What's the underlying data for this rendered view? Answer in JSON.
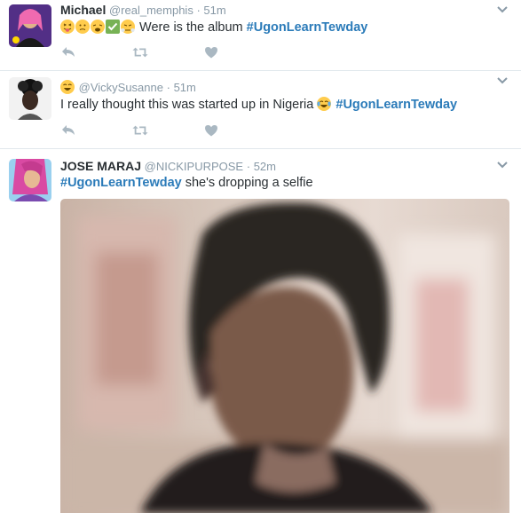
{
  "tweets": [
    {
      "name": "Michael",
      "handle": "@real_memphis",
      "separator": "·",
      "time": "51m",
      "emojis": [
        "squinting-tongue-emoji",
        "confused-face-emoji",
        "weary-face-emoji",
        "check-mark-emoji",
        "steam-nose-face-emoji"
      ],
      "text_before": "Were is the album",
      "hashtag": "#UgonLearnTewday",
      "text_after": ""
    },
    {
      "name": "",
      "handle": "@VickySusanne",
      "separator": "·",
      "time": "51m",
      "name_emoji": "laughing-face-emoji",
      "text_before": "I really thought this was started up in Nigeria",
      "inline_emoji": "tears-of-joy-emoji",
      "hashtag": "#UgonLearnTewday",
      "text_after": ""
    },
    {
      "name": "JOSE MARAJ",
      "handle": "@NICKIPURPOSE",
      "separator": "·",
      "time": "52m",
      "text_before": "",
      "hashtag": "#UgonLearnTewday",
      "text_after": "she's dropping a selfie",
      "media": "blurred-selfie-photo"
    }
  ],
  "actions": [
    "reply-icon",
    "retweet-icon",
    "like-icon"
  ],
  "colors": {
    "hashtag": "#2b7bb9",
    "meta": "#8899a6",
    "icon": "#aab8c2",
    "divider": "#e1e8ed"
  }
}
